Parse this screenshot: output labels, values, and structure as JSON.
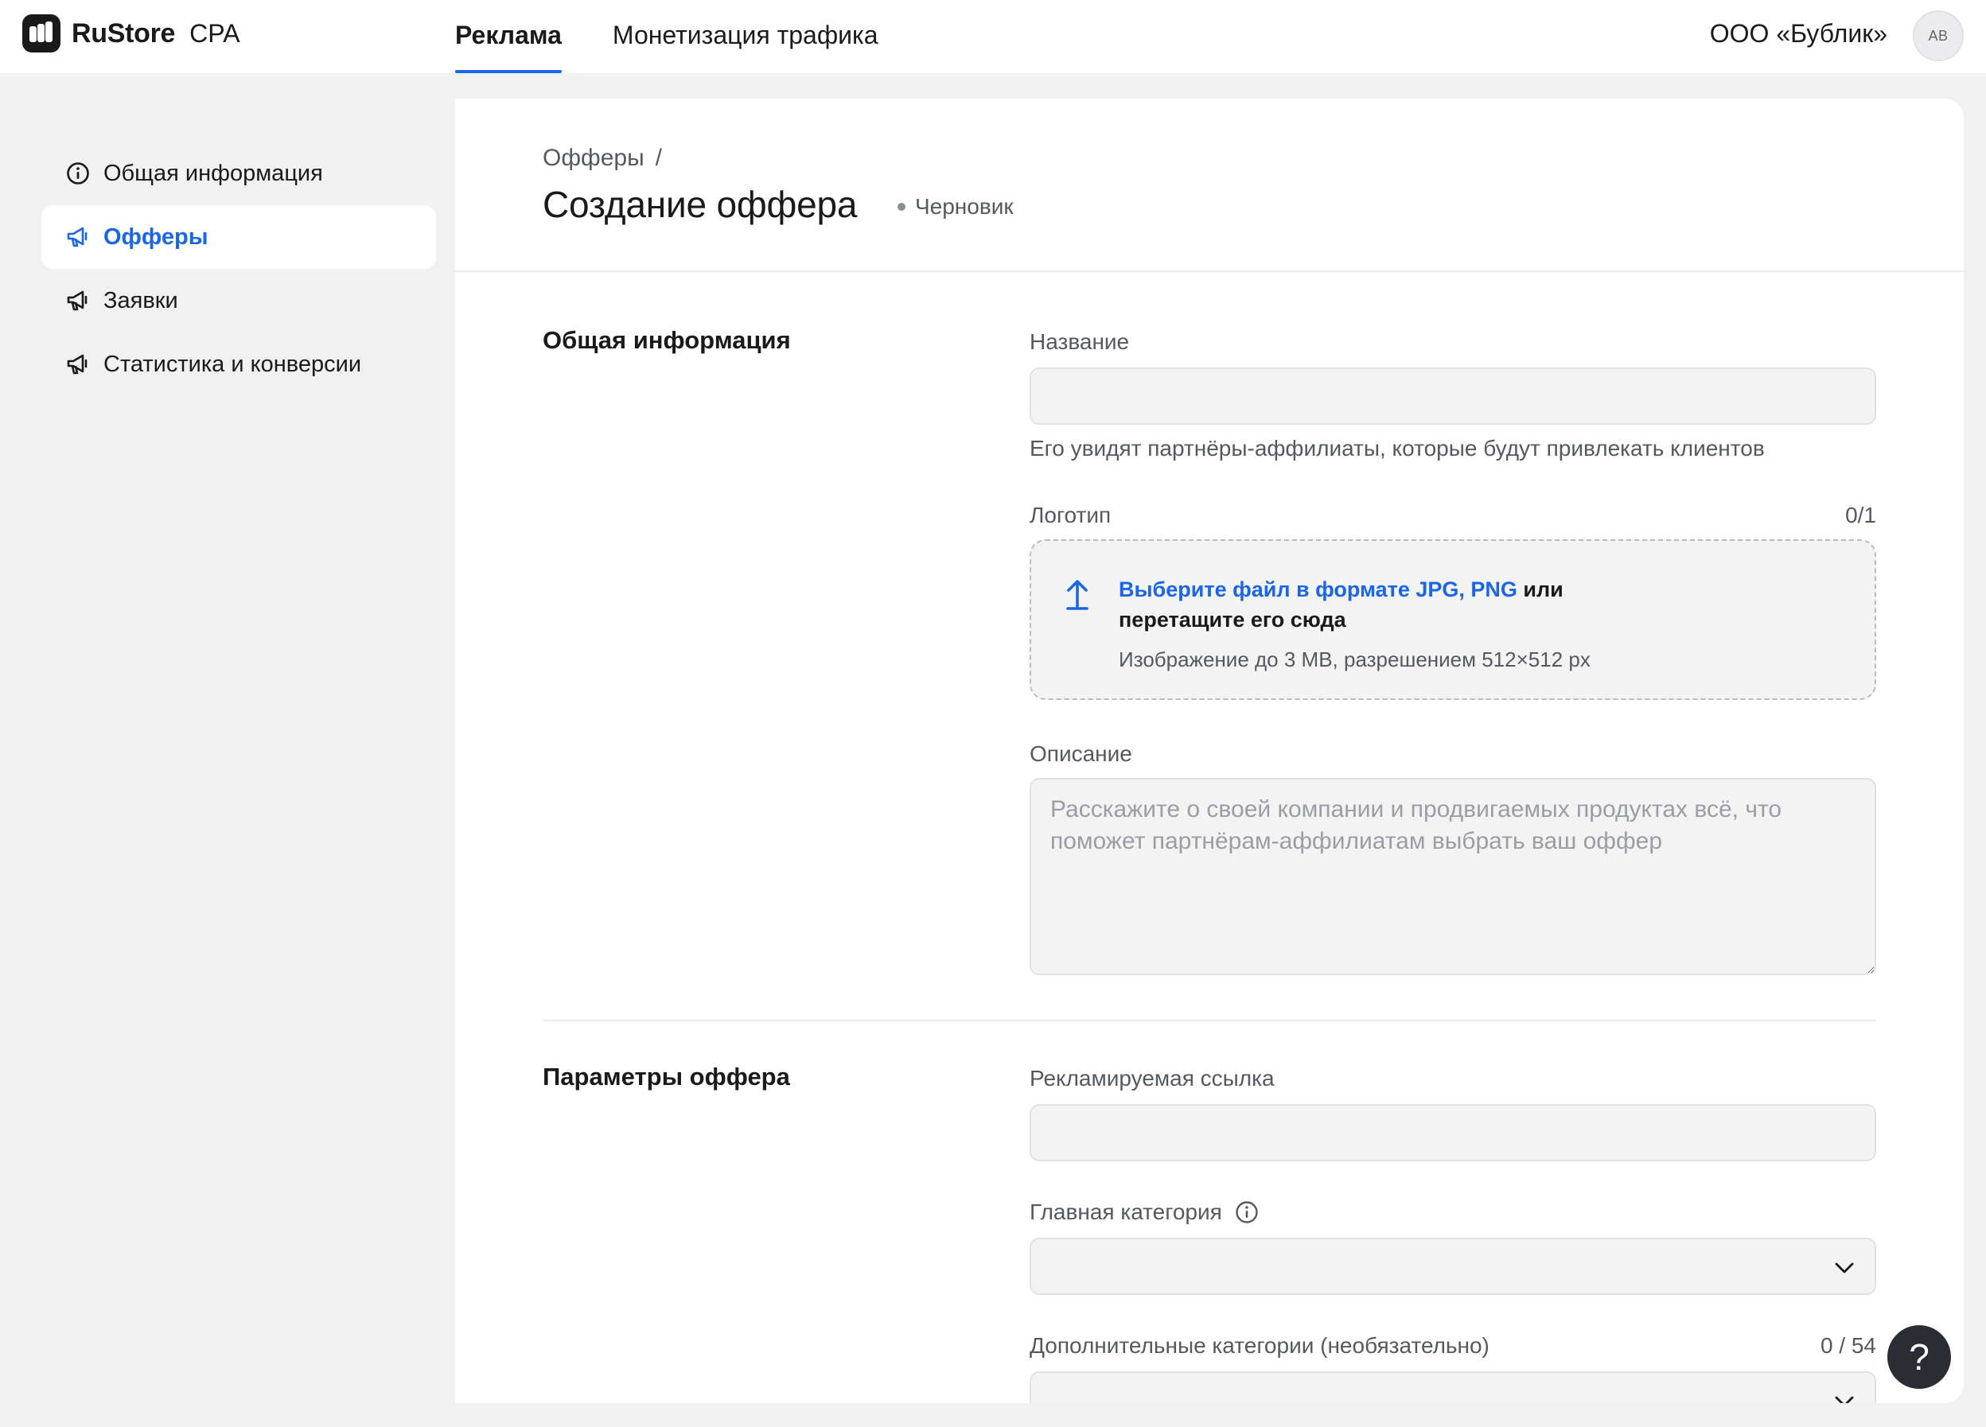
{
  "header": {
    "brand": "RuStore",
    "brand_sub": "CPA",
    "nav": [
      {
        "label": "Реклама",
        "active": true
      },
      {
        "label": "Монетизация трафика",
        "active": false
      }
    ],
    "org_name": "ООО «Бублик»",
    "avatar_initials": "AB"
  },
  "sidebar": {
    "items": [
      {
        "label": "Общая информация",
        "icon": "info-icon",
        "active": false
      },
      {
        "label": "Офферы",
        "icon": "megaphone-icon",
        "active": true
      },
      {
        "label": "Заявки",
        "icon": "megaphone-icon",
        "active": false
      },
      {
        "label": "Статистика и конверсии",
        "icon": "megaphone-icon",
        "active": false
      }
    ]
  },
  "page": {
    "breadcrumb": "Офферы",
    "breadcrumb_sep": "/",
    "title": "Создание оффера",
    "status": "Черновик"
  },
  "general": {
    "section_title": "Общая информация",
    "name_label": "Название",
    "name_value": "",
    "name_hint": "Его увидят партнёры-аффилиаты, которые будут привлекать клиентов",
    "logo_label": "Логотип",
    "logo_counter": "0/1",
    "dropzone_link": "Выберите файл в формате JPG, PNG",
    "dropzone_text": " или перетащите его сюда",
    "dropzone_sub": "Изображение до 3 MB, разрешением 512×512 px",
    "description_label": "Описание",
    "description_placeholder": "Расскажите о своей компании и продвигаемых продуктах всё, что поможет партнёрам-аффилиатам выбрать ваш оффер",
    "description_value": ""
  },
  "params": {
    "section_title": "Параметры оффера",
    "link_label": "Рекламируемая ссылка",
    "link_value": "",
    "main_category_label": "Главная категория",
    "main_category_value": "",
    "extra_categories_label": "Дополнительные категории (необязательно)",
    "extra_categories_counter": "0 / 54"
  },
  "help": {
    "label": "?"
  },
  "colors": {
    "accent": "#1a66e6",
    "sidebar_bg": "#f1f1f2",
    "help_bg": "#2a2d31"
  }
}
